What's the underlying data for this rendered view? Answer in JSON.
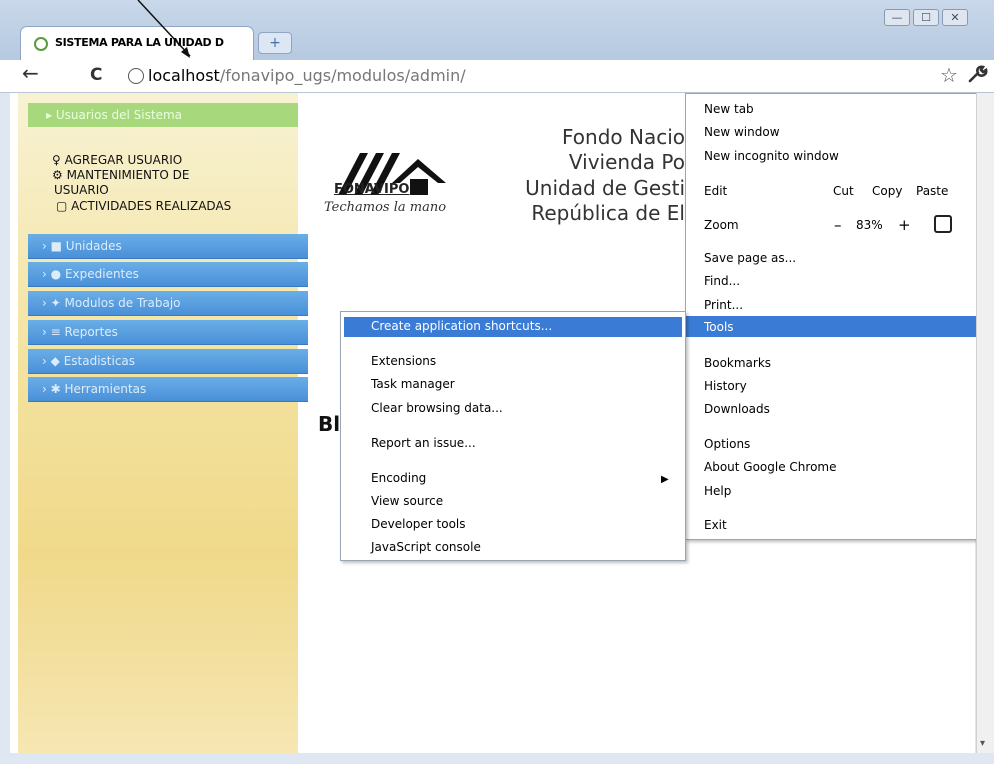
{
  "browser": {
    "tab_title": "SISTEMA PARA LA UNIDAD D",
    "new_tab_icon": "plus-icon",
    "url_host": "localhost",
    "url_path": "/fonavipo_ugs/modulos/admin/",
    "back_icon": "←",
    "reload_icon": "C",
    "star_icon": "☆",
    "wrench_icon": "🔧",
    "window_controls": [
      "—",
      "☐",
      "✕"
    ]
  },
  "sidebar": {
    "header": "Usuarios del Sistema",
    "links": [
      "AGREGAR USUARIO",
      "MANTENIMIENTO DE",
      "USUARIO",
      "ACTIVIDADES REALIZADAS"
    ],
    "items": [
      {
        "label": "Unidades"
      },
      {
        "label": "Expedientes"
      },
      {
        "label": "Modulos de Trabajo"
      },
      {
        "label": "Reportes"
      },
      {
        "label": "Estadisticas"
      },
      {
        "label": "Herramientas"
      }
    ]
  },
  "page": {
    "logo_name": "FONAVIPO",
    "logo_slogan": "Techamos la mano",
    "org_lines": [
      "Fondo Nacio",
      "Vivienda Po",
      "Unidad de Gesti",
      "República de El"
    ],
    "bl": "Bl"
  },
  "menu": {
    "new_tab": "New tab",
    "new_window": "New window",
    "new_incognito": "New incognito window",
    "edit": "Edit",
    "cut": "Cut",
    "copy": "Copy",
    "paste": "Paste",
    "zoom": "Zoom",
    "zoom_minus": "–",
    "zoom_value": "83%",
    "zoom_plus": "+",
    "save_page": "Save page as...",
    "find": "Find...",
    "print": "Print...",
    "tools": "Tools",
    "bookmarks": "Bookmarks",
    "history": "History",
    "downloads": "Downloads",
    "options": "Options",
    "about": "About Google Chrome",
    "help": "Help",
    "exit": "Exit"
  },
  "tools_submenu": {
    "items": [
      "Create application shortcuts...",
      "Extensions",
      "Task manager",
      "Clear browsing data...",
      "Report an issue...",
      "Encoding",
      "View source",
      "Developer tools",
      "JavaScript console"
    ]
  }
}
